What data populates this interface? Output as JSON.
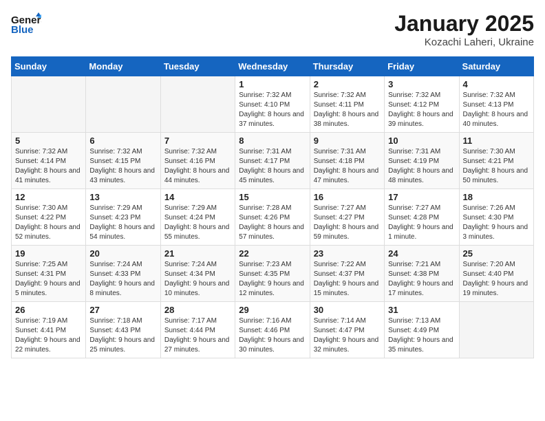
{
  "header": {
    "logo_general": "General",
    "logo_blue": "Blue",
    "month_year": "January 2025",
    "location": "Kozachi Laheri, Ukraine"
  },
  "weekdays": [
    "Sunday",
    "Monday",
    "Tuesday",
    "Wednesday",
    "Thursday",
    "Friday",
    "Saturday"
  ],
  "weeks": [
    [
      {
        "day": "",
        "info": ""
      },
      {
        "day": "",
        "info": ""
      },
      {
        "day": "",
        "info": ""
      },
      {
        "day": "1",
        "info": "Sunrise: 7:32 AM\nSunset: 4:10 PM\nDaylight: 8 hours and 37 minutes."
      },
      {
        "day": "2",
        "info": "Sunrise: 7:32 AM\nSunset: 4:11 PM\nDaylight: 8 hours and 38 minutes."
      },
      {
        "day": "3",
        "info": "Sunrise: 7:32 AM\nSunset: 4:12 PM\nDaylight: 8 hours and 39 minutes."
      },
      {
        "day": "4",
        "info": "Sunrise: 7:32 AM\nSunset: 4:13 PM\nDaylight: 8 hours and 40 minutes."
      }
    ],
    [
      {
        "day": "5",
        "info": "Sunrise: 7:32 AM\nSunset: 4:14 PM\nDaylight: 8 hours and 41 minutes."
      },
      {
        "day": "6",
        "info": "Sunrise: 7:32 AM\nSunset: 4:15 PM\nDaylight: 8 hours and 43 minutes."
      },
      {
        "day": "7",
        "info": "Sunrise: 7:32 AM\nSunset: 4:16 PM\nDaylight: 8 hours and 44 minutes."
      },
      {
        "day": "8",
        "info": "Sunrise: 7:31 AM\nSunset: 4:17 PM\nDaylight: 8 hours and 45 minutes."
      },
      {
        "day": "9",
        "info": "Sunrise: 7:31 AM\nSunset: 4:18 PM\nDaylight: 8 hours and 47 minutes."
      },
      {
        "day": "10",
        "info": "Sunrise: 7:31 AM\nSunset: 4:19 PM\nDaylight: 8 hours and 48 minutes."
      },
      {
        "day": "11",
        "info": "Sunrise: 7:30 AM\nSunset: 4:21 PM\nDaylight: 8 hours and 50 minutes."
      }
    ],
    [
      {
        "day": "12",
        "info": "Sunrise: 7:30 AM\nSunset: 4:22 PM\nDaylight: 8 hours and 52 minutes."
      },
      {
        "day": "13",
        "info": "Sunrise: 7:29 AM\nSunset: 4:23 PM\nDaylight: 8 hours and 54 minutes."
      },
      {
        "day": "14",
        "info": "Sunrise: 7:29 AM\nSunset: 4:24 PM\nDaylight: 8 hours and 55 minutes."
      },
      {
        "day": "15",
        "info": "Sunrise: 7:28 AM\nSunset: 4:26 PM\nDaylight: 8 hours and 57 minutes."
      },
      {
        "day": "16",
        "info": "Sunrise: 7:27 AM\nSunset: 4:27 PM\nDaylight: 8 hours and 59 minutes."
      },
      {
        "day": "17",
        "info": "Sunrise: 7:27 AM\nSunset: 4:28 PM\nDaylight: 9 hours and 1 minute."
      },
      {
        "day": "18",
        "info": "Sunrise: 7:26 AM\nSunset: 4:30 PM\nDaylight: 9 hours and 3 minutes."
      }
    ],
    [
      {
        "day": "19",
        "info": "Sunrise: 7:25 AM\nSunset: 4:31 PM\nDaylight: 9 hours and 5 minutes."
      },
      {
        "day": "20",
        "info": "Sunrise: 7:24 AM\nSunset: 4:33 PM\nDaylight: 9 hours and 8 minutes."
      },
      {
        "day": "21",
        "info": "Sunrise: 7:24 AM\nSunset: 4:34 PM\nDaylight: 9 hours and 10 minutes."
      },
      {
        "day": "22",
        "info": "Sunrise: 7:23 AM\nSunset: 4:35 PM\nDaylight: 9 hours and 12 minutes."
      },
      {
        "day": "23",
        "info": "Sunrise: 7:22 AM\nSunset: 4:37 PM\nDaylight: 9 hours and 15 minutes."
      },
      {
        "day": "24",
        "info": "Sunrise: 7:21 AM\nSunset: 4:38 PM\nDaylight: 9 hours and 17 minutes."
      },
      {
        "day": "25",
        "info": "Sunrise: 7:20 AM\nSunset: 4:40 PM\nDaylight: 9 hours and 19 minutes."
      }
    ],
    [
      {
        "day": "26",
        "info": "Sunrise: 7:19 AM\nSunset: 4:41 PM\nDaylight: 9 hours and 22 minutes."
      },
      {
        "day": "27",
        "info": "Sunrise: 7:18 AM\nSunset: 4:43 PM\nDaylight: 9 hours and 25 minutes."
      },
      {
        "day": "28",
        "info": "Sunrise: 7:17 AM\nSunset: 4:44 PM\nDaylight: 9 hours and 27 minutes."
      },
      {
        "day": "29",
        "info": "Sunrise: 7:16 AM\nSunset: 4:46 PM\nDaylight: 9 hours and 30 minutes."
      },
      {
        "day": "30",
        "info": "Sunrise: 7:14 AM\nSunset: 4:47 PM\nDaylight: 9 hours and 32 minutes."
      },
      {
        "day": "31",
        "info": "Sunrise: 7:13 AM\nSunset: 4:49 PM\nDaylight: 9 hours and 35 minutes."
      },
      {
        "day": "",
        "info": ""
      }
    ]
  ]
}
